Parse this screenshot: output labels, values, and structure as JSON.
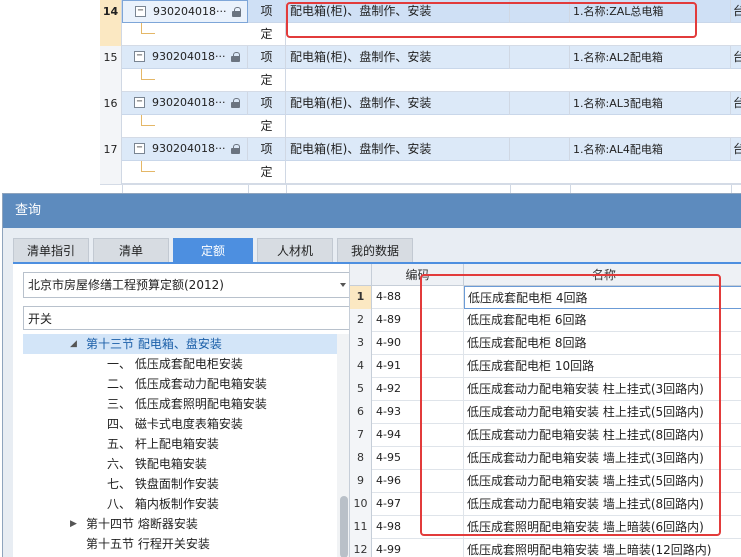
{
  "bill_rows": [
    {
      "num": "14",
      "code": "930204018···",
      "type_top": "项",
      "type_bottom": "定",
      "name": "配电箱(柜)、盘制作、安装",
      "feature": "1.名称:ZAL总电箱",
      "unit": "台",
      "selected": true
    },
    {
      "num": "15",
      "code": "930204018···",
      "type_top": "项",
      "type_bottom": "定",
      "name": "配电箱(柜)、盘制作、安装",
      "feature": "1.名称:AL2配电箱",
      "unit": "台",
      "selected": false
    },
    {
      "num": "16",
      "code": "930204018···",
      "type_top": "项",
      "type_bottom": "定",
      "name": "配电箱(柜)、盘制作、安装",
      "feature": "1.名称:AL3配电箱",
      "unit": "台",
      "selected": false
    },
    {
      "num": "17",
      "code": "930204018···",
      "type_top": "项",
      "type_bottom": "定",
      "name": "配电箱(柜)、盘制作、安装",
      "feature": "1.名称:AL4配电箱",
      "unit": "台",
      "selected": false
    }
  ],
  "dialog": {
    "title": "查询",
    "tabs": [
      {
        "label": "清单指引",
        "active": false
      },
      {
        "label": "清单",
        "active": false
      },
      {
        "label": "定额",
        "active": true
      },
      {
        "label": "人材机",
        "active": false
      },
      {
        "label": "我的数据",
        "active": false
      }
    ],
    "library_select": "北京市房屋修缮工程预算定额(2012)",
    "search_value": "开关",
    "tree": [
      {
        "label": "第十三节 配电箱、盘安装",
        "expanded": true,
        "selected": true
      },
      {
        "label": "一、 低压成套配电柜安装"
      },
      {
        "label": "二、 低压成套动力配电箱安装"
      },
      {
        "label": "三、 低压成套照明配电箱安装"
      },
      {
        "label": "四、 磁卡式电度表箱安装"
      },
      {
        "label": "五、 杆上配电箱安装"
      },
      {
        "label": "六、 铁配电箱安装"
      },
      {
        "label": "七、 铁盘面制作安装"
      },
      {
        "label": "八、 箱内板制作安装"
      },
      {
        "label": "第十四节 熔断器安装",
        "expanded": false
      },
      {
        "label": "第十五节 行程开关安装"
      }
    ],
    "grid": {
      "headers": {
        "code": "编码",
        "name": "名称"
      },
      "rows": [
        {
          "idx": "1",
          "code": "4-88",
          "name": "低压成套配电柜 4回路"
        },
        {
          "idx": "2",
          "code": "4-89",
          "name": "低压成套配电柜 6回路"
        },
        {
          "idx": "3",
          "code": "4-90",
          "name": "低压成套配电柜 8回路"
        },
        {
          "idx": "4",
          "code": "4-91",
          "name": "低压成套配电柜 10回路"
        },
        {
          "idx": "5",
          "code": "4-92",
          "name": "低压成套动力配电箱安装 柱上挂式(3回路内)"
        },
        {
          "idx": "6",
          "code": "4-93",
          "name": "低压成套动力配电箱安装 柱上挂式(5回路内)"
        },
        {
          "idx": "7",
          "code": "4-94",
          "name": "低压成套动力配电箱安装 柱上挂式(8回路内)"
        },
        {
          "idx": "8",
          "code": "4-95",
          "name": "低压成套动力配电箱安装 墙上挂式(3回路内)"
        },
        {
          "idx": "9",
          "code": "4-96",
          "name": "低压成套动力配电箱安装 墙上挂式(5回路内)"
        },
        {
          "idx": "10",
          "code": "4-97",
          "name": "低压成套动力配电箱安装 墙上挂式(8回路内)"
        },
        {
          "idx": "11",
          "code": "4-98",
          "name": "低压成套照明配电箱安装 墙上暗装(6回路内)"
        },
        {
          "idx": "12",
          "code": "4-99",
          "name": "低压成套照明配电箱安装 墙上暗装(12回路内)"
        }
      ]
    }
  },
  "colors": {
    "highlight_box": "#e23b3b",
    "title_bar": "#5d8bbe",
    "active_tab": "#4d8fe0"
  }
}
